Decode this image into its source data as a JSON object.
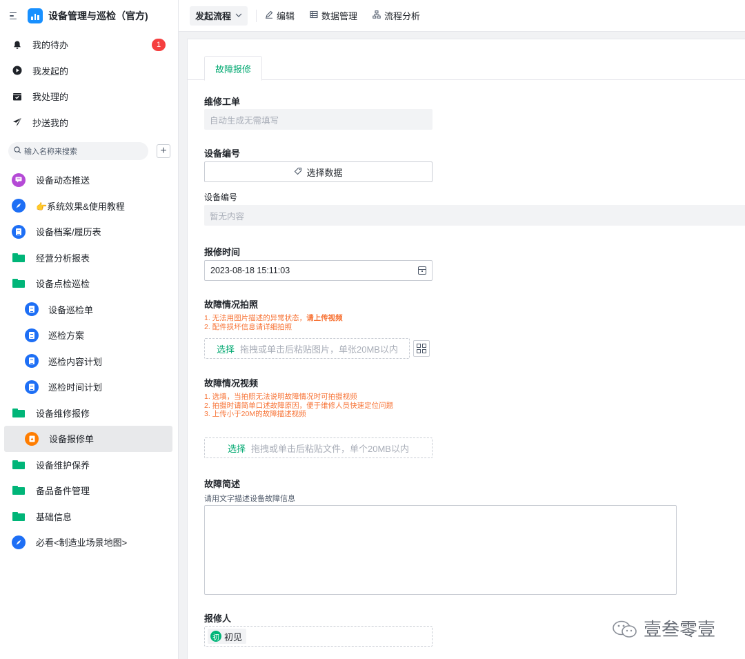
{
  "app": {
    "title": "设备管理与巡检（官方)"
  },
  "quick": [
    {
      "label": "我的待办",
      "icon": "bell-icon",
      "badge": "1"
    },
    {
      "label": "我发起的",
      "icon": "play-circle-icon"
    },
    {
      "label": "我处理的",
      "icon": "inbox-check-icon"
    },
    {
      "label": "抄送我的",
      "icon": "send-icon"
    }
  ],
  "search": {
    "placeholder": "输入名称来搜索",
    "add": "+"
  },
  "nav": [
    {
      "label": "设备动态推送",
      "icon": "message-icon",
      "color": "#b54ad6"
    },
    {
      "label": "👉系统效果&使用教程",
      "icon": "compass-icon",
      "color": "#1e6ff5"
    },
    {
      "label": "设备档案/履历表",
      "icon": "form-icon",
      "color": "#1e6ff5"
    },
    {
      "label": "经营分析报表",
      "icon": "folder-icon",
      "color": "#00b578"
    },
    {
      "label": "设备点检巡检",
      "icon": "folder-open-icon",
      "color": "#00b578"
    },
    {
      "label": "设备巡检单",
      "icon": "form-icon",
      "color": "#1e6ff5"
    },
    {
      "label": "巡检方案",
      "icon": "form-icon",
      "color": "#1e6ff5"
    },
    {
      "label": "巡检内容计划",
      "icon": "form-icon",
      "color": "#1e6ff5"
    },
    {
      "label": "巡检时间计划",
      "icon": "form-icon",
      "color": "#1e6ff5"
    },
    {
      "label": "设备维修报修",
      "icon": "folder-open-icon",
      "color": "#00b578"
    },
    {
      "label": "设备报修单",
      "icon": "repair-form-icon",
      "color": "#ff7d00"
    },
    {
      "label": "设备维护保养",
      "icon": "folder-icon",
      "color": "#00b578"
    },
    {
      "label": "备品备件管理",
      "icon": "folder-icon",
      "color": "#00b578"
    },
    {
      "label": "基础信息",
      "icon": "folder-icon",
      "color": "#00b578"
    },
    {
      "label": "必看<制造业场景地图>",
      "icon": "compass-icon",
      "color": "#1e6ff5"
    }
  ],
  "toolbar": {
    "flow": "发起流程",
    "edit": "编辑",
    "data_mgmt": "数据管理",
    "analysis": "流程分析"
  },
  "form": {
    "tab": "故障报修",
    "work_order": {
      "label": "维修工单",
      "placeholder": "自动生成无需填写"
    },
    "device_no": {
      "label": "设备编号",
      "button": "选择数据",
      "sub_label": "设备编号",
      "empty": "暂无内容"
    },
    "report_time": {
      "label": "报修时间",
      "value": "2023-08-18 15:11:03"
    },
    "photo": {
      "label": "故障情况拍照",
      "hint1a": "1. 无法用图片描述的异常状态，",
      "hint1b": "请上传视频",
      "hint2": "2. 配件损坏信息请详细拍照",
      "pick": "选择",
      "drop": "拖拽或单击后粘贴图片，单张20MB以内"
    },
    "video": {
      "label": "故障情况视频",
      "hint1": "1. 选填，当拍照无法说明故障情况时可拍摄视频",
      "hint2": "2. 拍摄时请简单口述故障原因，便于维修人员快速定位问题",
      "hint3": "3. 上传小于20M的故障描述视频",
      "pick": "选择",
      "drop": "拖拽或单击后粘贴文件，单个20MB以内"
    },
    "desc": {
      "label": "故障简述",
      "hint": "请用文字描述设备故障信息"
    },
    "reporter": {
      "label": "报修人",
      "avatar": "初",
      "name": "初见"
    }
  },
  "watermark": "壹叁零壹"
}
